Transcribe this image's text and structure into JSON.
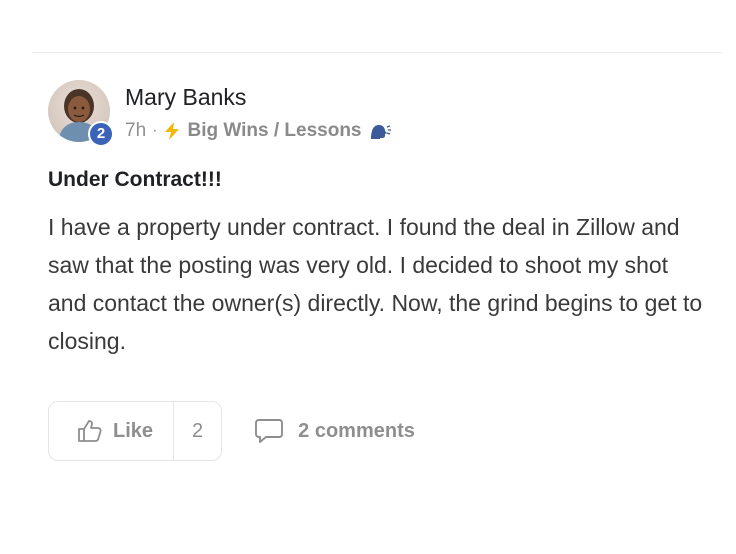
{
  "post": {
    "author": {
      "name": "Mary Banks",
      "level": "2"
    },
    "time": "7h",
    "separator": "·",
    "category": "Big Wins / Lessons",
    "title": "Under Contract!!!",
    "body": "I have a property under contract. I found the deal in Zillow and saw that the posting was very old. I decided to shoot my shot and contact the owner(s) directly. Now, the grind begins to get to closing."
  },
  "actions": {
    "like_label": "Like",
    "like_count": "2",
    "comments_label": "2 comments"
  },
  "icons": {
    "bolt": "lightning-bolt-icon",
    "speaker": "speaking-head-icon",
    "like": "thumbs-up-icon",
    "comment": "comment-bubble-icon"
  },
  "colors": {
    "level_badge": "#3b64b8",
    "bolt": "#f2b705",
    "muted_text": "#8e8e8e"
  }
}
